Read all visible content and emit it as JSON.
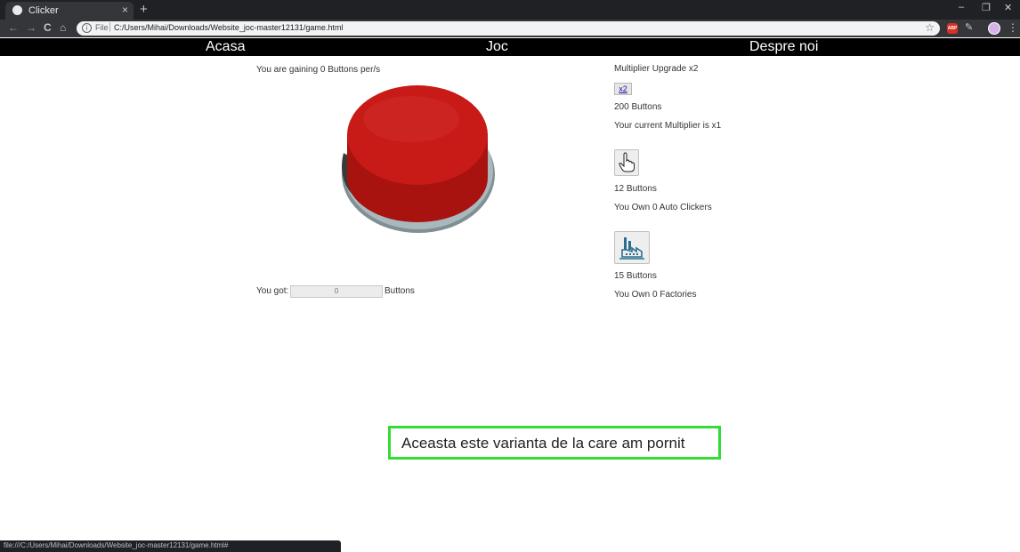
{
  "browser": {
    "tab_title": "Clicker",
    "tab_close": "×",
    "new_tab": "+",
    "window_controls": {
      "minimize": "–",
      "restore": "❐",
      "close": "✕"
    },
    "nav": {
      "back": "←",
      "forward": "→",
      "reload": "C",
      "home": "⌂"
    },
    "url_scheme": "File",
    "url_separator": "|",
    "url": "C:/Users/Mihai/Downloads/Website_joc-master12131/game.html",
    "star": "☆",
    "ext_abp": "ABP",
    "ext_pen": "✎",
    "menu": "⋮",
    "status_url": "file:///C:/Users/Mihai/Downloads/Website_joc-master12131/game.html#"
  },
  "navbar": {
    "items": [
      {
        "label": "Acasa"
      },
      {
        "label": "Joc"
      },
      {
        "label": "Despre noi"
      }
    ]
  },
  "game": {
    "gaining_text": "You are gaining 0 Buttons per/s",
    "got_label": "You got:",
    "counter_value": "0",
    "counter_unit": "Buttons"
  },
  "shop": {
    "multiplier_title": "Multiplier Upgrade x2",
    "multiplier_button": "x2",
    "multiplier_cost": "200 Buttons",
    "current_multiplier": "Your current Multiplier is x1",
    "autoclicker_cost": "12 Buttons",
    "autoclicker_owned": "You Own 0 Auto Clickers",
    "factory_cost": "15 Buttons",
    "factory_owned": "You Own 0 Factories"
  },
  "annotation": {
    "text": "Aceasta este varianta de la care am pornit",
    "border_color": "#33dd33"
  },
  "colors": {
    "button_red": "#c81a16",
    "button_base": "#a9b8bd",
    "navbar_bg": "#000000"
  },
  "icons": {
    "tab_favicon": "globe-icon",
    "autoclicker": "hand-pointer-icon",
    "factory": "factory-icon"
  }
}
